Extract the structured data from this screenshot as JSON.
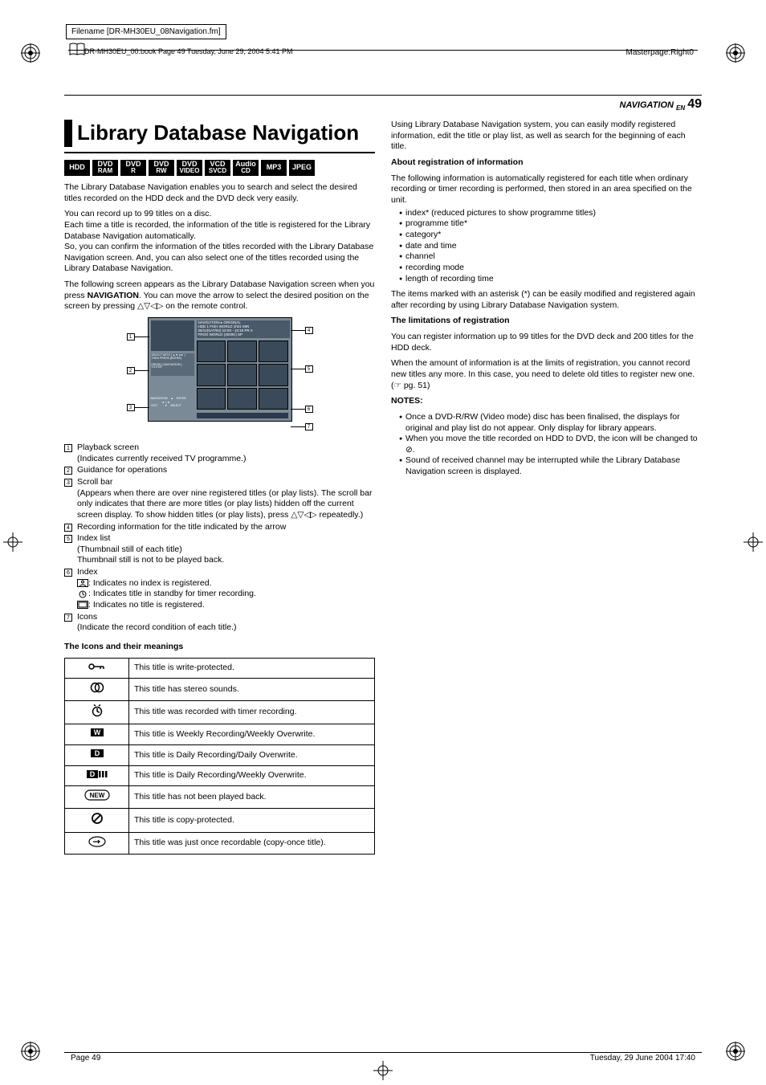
{
  "meta": {
    "filename": "Filename [DR-MH30EU_08Navigation.fm]",
    "book_header": "DR-MH30EU_00.book  Page 49  Tuesday, June 29, 2004  5:41 PM",
    "masterpage": "Masterpage:Right0"
  },
  "header": {
    "section": "NAVIGATION",
    "lang": "EN",
    "page": "49"
  },
  "title": "Library Database Navigation",
  "badges": [
    {
      "l1": "HDD"
    },
    {
      "l1": "DVD",
      "l2": "RAM"
    },
    {
      "l1": "DVD",
      "l2": "R"
    },
    {
      "l1": "DVD",
      "l2": "RW"
    },
    {
      "l1": "DVD",
      "l2": "VIDEO"
    },
    {
      "l1": "VCD",
      "l2": "SVCD"
    },
    {
      "l1": "Audio",
      "l2": "CD"
    },
    {
      "l1": "MP3"
    },
    {
      "l1": "JPEG"
    }
  ],
  "left": {
    "p1": "The Library Database Navigation enables you to search and select the desired titles recorded on the HDD deck and the DVD deck very easily.",
    "p2": "You can record up to 99 titles on a disc.",
    "p3": "Each time a title is recorded, the information of the title is registered for the Library Database Navigation automatically.",
    "p4": "So, you can confirm the information of the titles recorded with the Library Database Navigation screen. And, you can also select one of the titles recorded using the Library Database Navigation.",
    "p5a": "The following screen appears as the Library Database Navigation screen when you press ",
    "p5_nav": "NAVIGATION",
    "p5b": ". You can move the arrow to select the desired position on the screen by pressing ",
    "p5c": " on the remote control.",
    "tv": {
      "hdr1": "NAVIGATION ▸ ORIGINAL",
      "hdr2": "HDD   1 FISH WORLD                    1h01 MIN",
      "hdr3": "25/12(SAT/04)   10:00 - 10:15            PR   3",
      "hdr4": "FROG WORLD                              (4000K)  SP",
      "guide1": "SELECT WITH [ ▲▼◄► ]",
      "guide2": "THEN PRESS [ENTER]",
      "guide3": "PRESS [ NAVIGATION ]",
      "guide4": "TO EXIT",
      "enter": "NAVIGATION    ▲    ENTER\n              ◄ ○ ►\n EXIT         ▼    SELECT"
    },
    "numbered": [
      {
        "n": "1",
        "head": "Playback screen",
        "body": "(Indicates currently received TV programme.)"
      },
      {
        "n": "2",
        "head": "Guidance for operations",
        "body": ""
      },
      {
        "n": "3",
        "head": "Scroll bar",
        "body": "(Appears when there are over nine registered titles (or play lists). The scroll bar only indicates that there are more titles (or play lists) hidden off the current screen display. To show hidden titles (or play lists), press △▽◁▷ repeatedly.)"
      },
      {
        "n": "4",
        "head": "Recording information for the title indicated by the arrow",
        "body": ""
      },
      {
        "n": "5",
        "head": "Index list",
        "body": "(Thumbnail still of each title)\nThumbnail still is not to be played back."
      },
      {
        "n": "6",
        "head": "Index",
        "body": ""
      },
      {
        "n": "7",
        "head": "Icons",
        "body": "(Indicate the record condition of each title.)"
      }
    ],
    "index_sub": {
      "a": ":   Indicates no index is registered.",
      "b": ":   Indicates title in standby for timer recording.",
      "c": ":   Indicates no title is registered."
    },
    "icons_heading": "The Icons and their meanings",
    "icon_table": [
      {
        "meaning": "This title is write-protected."
      },
      {
        "meaning": "This title has stereo sounds."
      },
      {
        "meaning": "This title was recorded with timer recording."
      },
      {
        "meaning": "This title is Weekly Recording/Weekly Overwrite."
      },
      {
        "meaning": "This title is Daily Recording/Daily Overwrite."
      },
      {
        "meaning": "This title is Daily Recording/Weekly Overwrite."
      },
      {
        "meaning": "This title has not been played back."
      },
      {
        "meaning": "This title is copy-protected."
      },
      {
        "meaning": "This title was just once recordable (copy-once title)."
      }
    ]
  },
  "right": {
    "intro": "Using Library Database Navigation system, you can easily modify registered information, edit the title or play list, as well as search for the beginning of each title.",
    "reg_h": "About registration of information",
    "reg_p": "The following information is automatically registered for each title when ordinary recording or timer recording is performed, then stored in an area specified on the unit.",
    "reg_list": [
      "index* (reduced pictures to show programme titles)",
      "programme title*",
      "category*",
      "date and time",
      "channel",
      "recording mode",
      "length of recording time"
    ],
    "reg_p2": "The items marked with an asterisk (*) can be easily modified and registered again after recording by using Library Database Navigation system.",
    "lim_h": "The limitations of registration",
    "lim_p1": "You can register information up to 99 titles for the DVD deck and 200 titles for the HDD deck.",
    "lim_p2": "When the amount of information is at the limits of registration, you cannot record new titles any more. In this case, you need to delete old titles to register new one. (☞ pg. 51)",
    "notes_h": "NOTES:",
    "notes": [
      "Once a DVD-R/RW (Video mode) disc has been finalised, the displays for original and play list do not appear. Only display for library appears.",
      "When you move the title recorded on HDD to DVD, the icon will be changed to ⊘.",
      "Sound of received channel may be interrupted while the Library Database Navigation screen is displayed."
    ]
  },
  "footer": {
    "left": "Page 49",
    "right": "Tuesday, 29 June 2004  17:40"
  }
}
